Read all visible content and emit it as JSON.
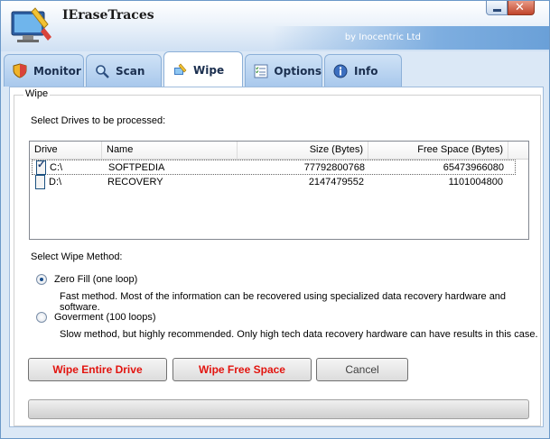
{
  "window": {
    "title": "IEraseTraces",
    "subtitle": "by Inocentric Ltd",
    "close_glyph": "✕"
  },
  "tabs": [
    {
      "label": "Monitor",
      "icon": "shield-icon"
    },
    {
      "label": "Scan",
      "icon": "magnifier-icon"
    },
    {
      "label": "Wipe",
      "icon": "brush-icon",
      "active": true
    },
    {
      "label": "Options",
      "icon": "checklist-icon"
    },
    {
      "label": "Info",
      "icon": "info-icon"
    }
  ],
  "wipe": {
    "group_label": "Wipe",
    "drives_label": "Select Drives to be processed:",
    "columns": [
      "Drive",
      "Name",
      "Size (Bytes)",
      "Free Space (Bytes)"
    ],
    "drives": [
      {
        "drive": "C:\\",
        "name": "SOFTPEDIA",
        "size": "77792800768",
        "free": "65473966080",
        "checked": true
      },
      {
        "drive": "D:\\",
        "name": "RECOVERY",
        "size": "2147479552",
        "free": "1101004800",
        "checked": false
      }
    ],
    "method_label": "Select Wipe Method:",
    "methods": [
      {
        "label": "Zero Fill (one loop)",
        "description": "Fast method. Most of the information can be recovered using specialized data recovery hardware and software.",
        "selected": true
      },
      {
        "label": "Goverment (100 loops)",
        "description": "Slow method, but highly recommended. Only high tech data recovery hardware can have results in this case.",
        "selected": false
      }
    ],
    "buttons": {
      "wipe_drive": "Wipe Entire Drive",
      "wipe_free": "Wipe Free Space",
      "cancel": "Cancel"
    },
    "progress": 0
  },
  "colors": {
    "accent": "#6aa0d8",
    "button_red": "#e2140f"
  }
}
